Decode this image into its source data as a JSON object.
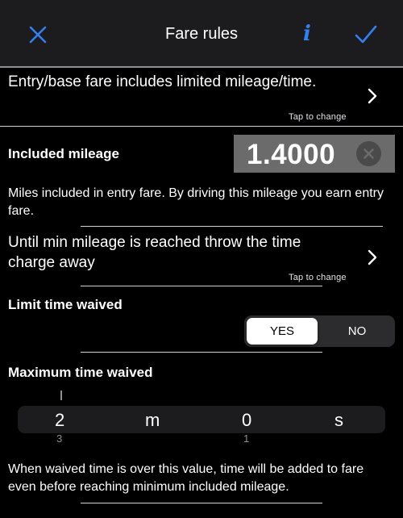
{
  "nav": {
    "title": "Fare rules",
    "close_icon": "close-icon",
    "info_icon": "info-icon",
    "done_icon": "checkmark-icon",
    "info_glyph": "i",
    "accent_color": "#2e82f5"
  },
  "entry_fare": {
    "text": "Entry/base fare includes limited mileage/time.",
    "hint": "Tap to change"
  },
  "included_mileage": {
    "label": "Included mileage",
    "value": "1.4000",
    "description": "Miles included in entry fare. By driving this mileage you earn entry fare."
  },
  "min_mileage": {
    "text": "Until min mileage is reached throw the time charge away",
    "hint": "Tap to change"
  },
  "limit_time_waived": {
    "label": "Limit time waived",
    "options": [
      "YES",
      "NO"
    ],
    "selected": "YES"
  },
  "max_time_waived": {
    "label": "Maximum time waived",
    "minutes": "2",
    "minutes_unit": "m",
    "seconds": "0",
    "seconds_unit": "s",
    "minutes_next": "3",
    "seconds_next": "1",
    "description": "When waived time is over this value, time will be added to fare even before reaching minimum included mileage."
  }
}
